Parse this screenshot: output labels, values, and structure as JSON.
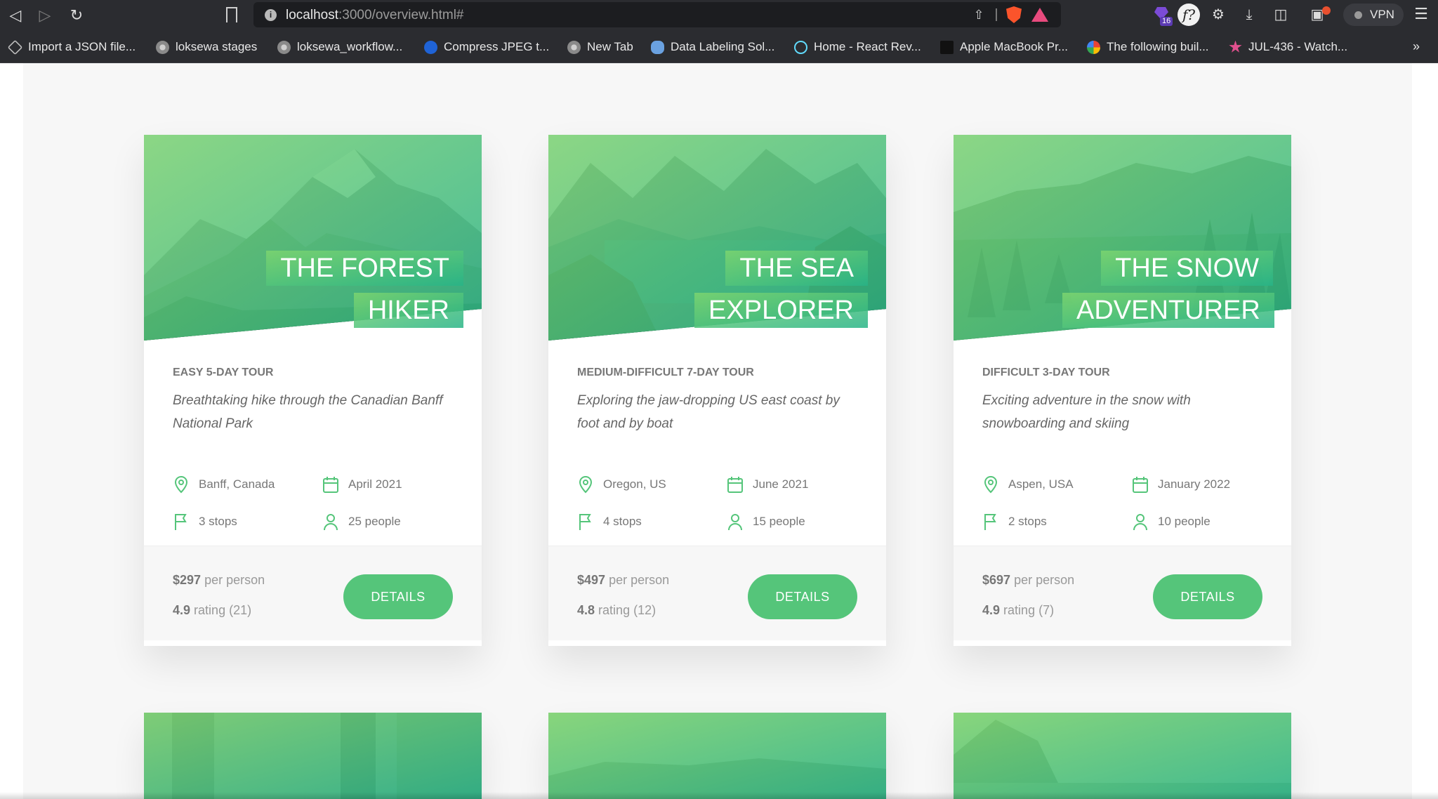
{
  "browser": {
    "url_host": "localhost",
    "url_path": ":3000/overview.html#",
    "vpn_label": "VPN",
    "extension_badge_count": "16",
    "bookmarks": [
      {
        "label": "Import a JSON file...",
        "icon": "box-icon"
      },
      {
        "label": "loksewa stages",
        "icon": "globe-icon"
      },
      {
        "label": "loksewa_workflow...",
        "icon": "globe-icon"
      },
      {
        "label": "Compress JPEG t...",
        "icon": "compress-icon"
      },
      {
        "label": "New Tab",
        "icon": "globe-icon"
      },
      {
        "label": "Data Labeling Sol...",
        "icon": "cloud-icon"
      },
      {
        "label": "Home - React Rev...",
        "icon": "react-icon"
      },
      {
        "label": "Apple MacBook Pr...",
        "icon": "store-icon"
      },
      {
        "label": "The following buil...",
        "icon": "google-icon"
      },
      {
        "label": "JUL-436 - Watch...",
        "icon": "jira-icon"
      }
    ],
    "bookmarks_overflow": "»"
  },
  "colors": {
    "primary_green": "#55c57a",
    "gradient_light": "#7dd56f",
    "gradient_dark": "#28b487"
  },
  "tours": [
    {
      "heading_line1": "THE FOREST",
      "heading_line2": "HIKER",
      "subheading": "EASY 5-DAY TOUR",
      "description": "Breathtaking hike through the Canadian Banff National Park",
      "location": "Banff, Canada",
      "date": "April 2021",
      "stops": "3 stops",
      "people": "25 people",
      "price": "$297",
      "price_suffix": "per person",
      "rating_value": "4.9",
      "rating_suffix": "rating (21)",
      "button": "DETAILS"
    },
    {
      "heading_line1": "THE SEA",
      "heading_line2": "EXPLORER",
      "subheading": "MEDIUM-DIFFICULT 7-DAY TOUR",
      "description": "Exploring the jaw-dropping US east coast by foot and by boat",
      "location": "Oregon, US",
      "date": "June 2021",
      "stops": "4 stops",
      "people": "15 people",
      "price": "$497",
      "price_suffix": "per person",
      "rating_value": "4.8",
      "rating_suffix": "rating (12)",
      "button": "DETAILS"
    },
    {
      "heading_line1": "THE SNOW",
      "heading_line2": "ADVENTURER",
      "subheading": "DIFFICULT 3-DAY TOUR",
      "description": "Exciting adventure in the snow with snowboarding and skiing",
      "location": "Aspen, USA",
      "date": "January 2022",
      "stops": "2 stops",
      "people": "10 people",
      "price": "$697",
      "price_suffix": "per person",
      "rating_value": "4.9",
      "rating_suffix": "rating (7)",
      "button": "DETAILS"
    }
  ]
}
